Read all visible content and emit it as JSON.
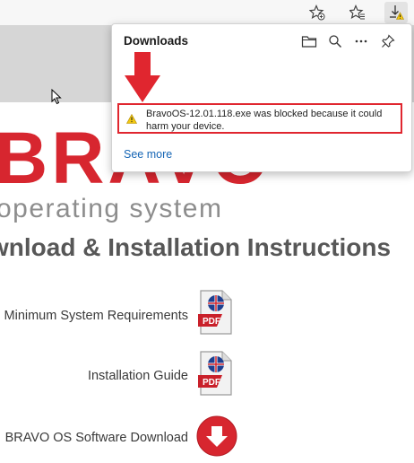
{
  "toolbar": {
    "buttons": [
      {
        "name": "favorites-add-icon"
      },
      {
        "name": "favorites-icon"
      },
      {
        "name": "downloads-warning-icon"
      }
    ]
  },
  "page": {
    "logo": "BRAVO",
    "tagline": "operating system",
    "heading": "wnload & Installation Instructions",
    "items": [
      {
        "label": "Minimum System Requirements",
        "icon": "pdf-icon"
      },
      {
        "label": "Installation Guide",
        "icon": "pdf-icon"
      },
      {
        "label": "BRAVO OS Software Download",
        "icon": "download-icon"
      }
    ]
  },
  "downloads": {
    "title": "Downloads",
    "actions": [
      "folder-icon",
      "search-icon",
      "more-icon",
      "pin-icon"
    ],
    "blocked_message": "BravoOS-12.01.118.exe was blocked because it could harm your device.",
    "see_more": "See more"
  },
  "colors": {
    "brand_red": "#d7262f",
    "link_blue": "#1565b5",
    "warning_yellow": "#f2c811"
  }
}
